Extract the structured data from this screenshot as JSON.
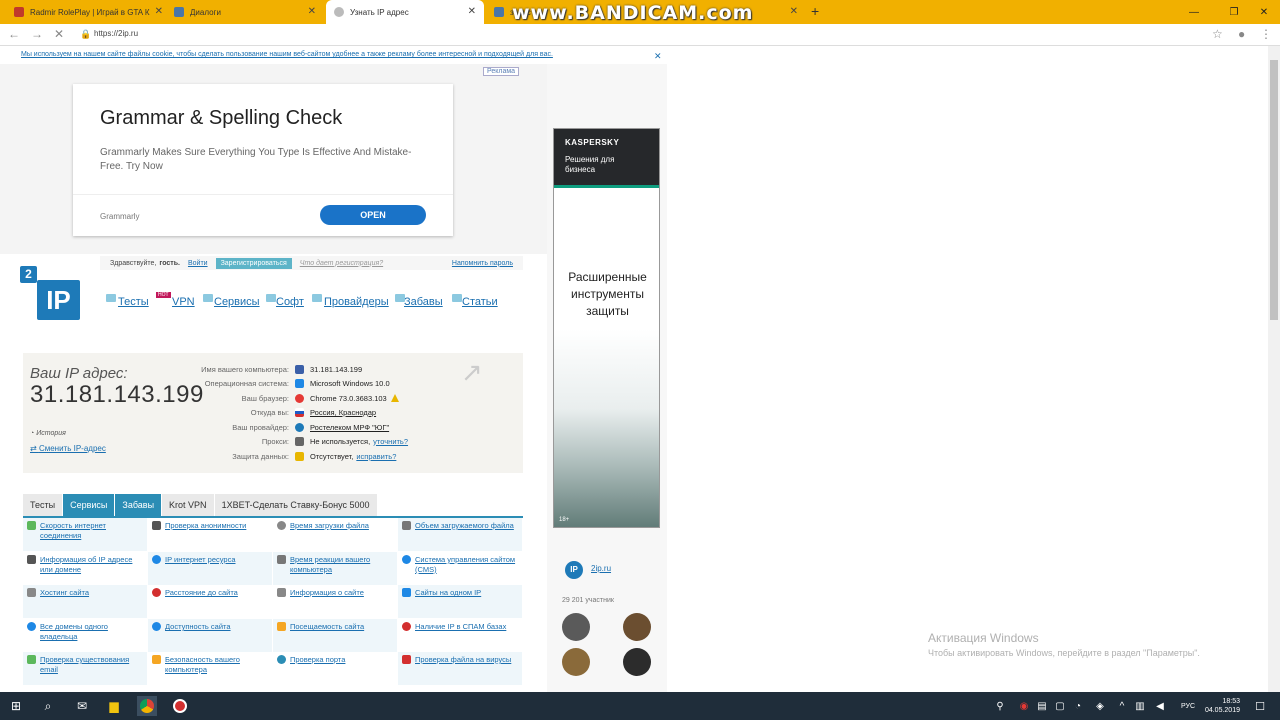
{
  "browser": {
    "tabs": [
      {
        "title": "Radmir RolePlay | Играй в GTA К",
        "color": "#c0392b"
      },
      {
        "title": "Диалоги",
        "color": "#4a76a8"
      },
      {
        "title": "Узнать IP адрес",
        "color": "#888888"
      },
      {
        "title": "завис",
        "color": "#4a76a8"
      }
    ],
    "new_tab_icon": "plus-icon",
    "url": "https://2ip.ru"
  },
  "overlay": {
    "watermark": "www.BANDICAM.com"
  },
  "cookie_notice": "Мы используем на нашем сайте файлы cookie, чтобы сделать пользование нашим веб-сайтом удобнее а также рекламу более интересной и подходящей для вас.",
  "ad": {
    "label": "Реклама",
    "title": "Grammar & Spelling Check",
    "description": "Grammarly Makes Sure Everything You Type Is Effective And Mistake-Free. Try Now",
    "brand": "Grammarly",
    "button": "OPEN"
  },
  "header": {
    "greeting": "Здравствуйте,",
    "guest": "гость.",
    "login": "Войти",
    "register": "Зарегистрироваться",
    "why_register": "Что дает регистрация?",
    "remind_password": "Напомнить пароль",
    "nav": [
      {
        "label": "Тесты"
      },
      {
        "label": "VPN",
        "badge": "HOT"
      },
      {
        "label": "Сервисы"
      },
      {
        "label": "Софт"
      },
      {
        "label": "Провайдеры"
      },
      {
        "label": "Забавы"
      },
      {
        "label": "Статьи"
      }
    ]
  },
  "ipinfo": {
    "label": "Ваш IP адрес:",
    "ip": "31.181.143.199",
    "history": "История",
    "change_ip": "Сменить IP-адрес",
    "rows": [
      {
        "key": "Имя вашего компьютера:",
        "value": "31.181.143.199",
        "icon_color": "#3a5fa8"
      },
      {
        "key": "Операционная система:",
        "value": "Microsoft Windows 10.0",
        "icon_color": "#1e88e5"
      },
      {
        "key": "Ваш браузер:",
        "value": "Chrome 73.0.3683.103",
        "icon_color": "#e53935"
      },
      {
        "key": "Откуда вы:",
        "value": "Россия, Краснодар",
        "icon_color": "#d32f2f"
      },
      {
        "key": "Ваш провайдер:",
        "value": "Ростелеком МРФ \"ЮГ\"",
        "icon_color": "#1e7ab8"
      },
      {
        "key": "Прокси:",
        "value": "Не используется,",
        "extra": "уточнить?",
        "icon_color": "#666666"
      },
      {
        "key": "Защита данных:",
        "value": "Отсутствует,",
        "extra": "исправить?",
        "icon_color": "#e8b600"
      }
    ]
  },
  "tools": {
    "tabs": [
      "Тесты",
      "Сервисы",
      "Забавы",
      "Krot VPN",
      "1XBET-Сделать Ставку-Бонус 5000"
    ],
    "items": [
      "Скорость интернет соединения",
      "Проверка анонимности",
      "Время загрузки файла",
      "Объем загружаемого файла",
      "Информация об IP адресе или домене",
      "IP интернет ресурса",
      "Время реакции вашего компьютера",
      "Система управления сайтом (CMS)",
      "Хостинг сайта",
      "Расстояние до сайта",
      "Информация о сайте",
      "Сайты на одном IP",
      "Все домены одного владельца",
      "Доступность сайта",
      "Посещаемость сайта",
      "Наличие IP в СПАМ базах",
      "Проверка существования email",
      "Безопасность вашего компьютера",
      "Проверка порта",
      "Проверка файла на вирусы"
    ]
  },
  "side_ad": {
    "brand": "KASPERSKY",
    "subtitle": "Решения для бизнеса",
    "text": "Расширенные инструменты защиты",
    "age": "18+"
  },
  "community": {
    "name": "2ip.ru",
    "members": "29 201 участник"
  },
  "windows": {
    "activation_title": "Активация Windows",
    "activation_text": "Чтобы активировать Windows, перейдите в раздел \"Параметры\".",
    "lang": "РУС",
    "time": "18:53",
    "date": "04.05.2019"
  }
}
